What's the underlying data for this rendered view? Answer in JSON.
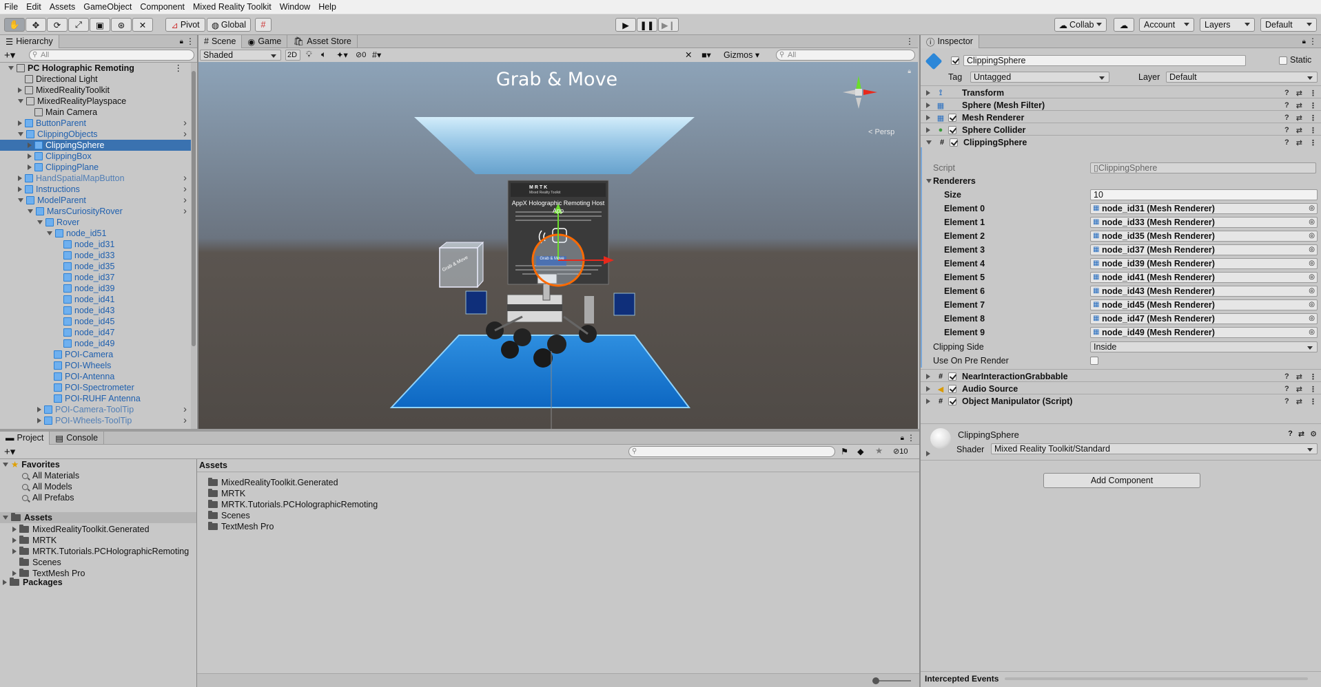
{
  "menu": [
    "File",
    "Edit",
    "Assets",
    "GameObject",
    "Component",
    "Mixed Reality Toolkit",
    "Window",
    "Help"
  ],
  "toolbar": {
    "pivot": "Pivot",
    "global": "Global",
    "collab": "Collab",
    "account": "Account",
    "layers": "Layers",
    "layout": "Default"
  },
  "hierarchy": {
    "tab": "Hierarchy",
    "search_placeholder": "All",
    "rows": [
      {
        "label": "PC Holographic Remoting",
        "depth": 0,
        "expand": "down",
        "blue": false,
        "bold": true,
        "icon": "unity-scene-icon"
      },
      {
        "label": "Directional Light",
        "depth": 1,
        "expand": "",
        "blue": false
      },
      {
        "label": "MixedRealityToolkit",
        "depth": 1,
        "expand": "right",
        "blue": false
      },
      {
        "label": "MixedRealityPlayspace",
        "depth": 1,
        "expand": "down",
        "blue": false
      },
      {
        "label": "Main Camera",
        "depth": 2,
        "expand": "",
        "blue": false
      },
      {
        "label": "ButtonParent",
        "depth": 1,
        "expand": "right",
        "blue": true,
        "chev": true
      },
      {
        "label": "ClippingObjects",
        "depth": 1,
        "expand": "down",
        "blue": true,
        "chev": true
      },
      {
        "label": "ClippingSphere",
        "depth": 2,
        "expand": "right",
        "blue": true,
        "selected": true
      },
      {
        "label": "ClippingBox",
        "depth": 2,
        "expand": "right",
        "blue": true
      },
      {
        "label": "ClippingPlane",
        "depth": 2,
        "expand": "right",
        "blue": true
      },
      {
        "label": "HandSpatialMapButton",
        "depth": 1,
        "expand": "right",
        "blue": true,
        "chev": true,
        "dim": true
      },
      {
        "label": "Instructions",
        "depth": 1,
        "expand": "right",
        "blue": true,
        "chev": true
      },
      {
        "label": "ModelParent",
        "depth": 1,
        "expand": "down",
        "blue": true,
        "chev": true
      },
      {
        "label": "MarsCuriosityRover",
        "depth": 2,
        "expand": "down",
        "blue": true,
        "chev": true
      },
      {
        "label": "Rover",
        "depth": 3,
        "expand": "down",
        "blue": true
      },
      {
        "label": "node_id51",
        "depth": 4,
        "expand": "down",
        "blue": true
      },
      {
        "label": "node_id31",
        "depth": 5,
        "expand": "",
        "blue": true
      },
      {
        "label": "node_id33",
        "depth": 5,
        "expand": "",
        "blue": true
      },
      {
        "label": "node_id35",
        "depth": 5,
        "expand": "",
        "blue": true
      },
      {
        "label": "node_id37",
        "depth": 5,
        "expand": "",
        "blue": true
      },
      {
        "label": "node_id39",
        "depth": 5,
        "expand": "",
        "blue": true
      },
      {
        "label": "node_id41",
        "depth": 5,
        "expand": "",
        "blue": true
      },
      {
        "label": "node_id43",
        "depth": 5,
        "expand": "",
        "blue": true
      },
      {
        "label": "node_id45",
        "depth": 5,
        "expand": "",
        "blue": true
      },
      {
        "label": "node_id47",
        "depth": 5,
        "expand": "",
        "blue": true
      },
      {
        "label": "node_id49",
        "depth": 5,
        "expand": "",
        "blue": true
      },
      {
        "label": "POI-Camera",
        "depth": 4,
        "expand": "",
        "blue": true
      },
      {
        "label": "POI-Wheels",
        "depth": 4,
        "expand": "",
        "blue": true
      },
      {
        "label": "POI-Antenna",
        "depth": 4,
        "expand": "",
        "blue": true
      },
      {
        "label": "POI-Spectrometer",
        "depth": 4,
        "expand": "",
        "blue": true
      },
      {
        "label": "POI-RUHF Antenna",
        "depth": 4,
        "expand": "",
        "blue": true
      },
      {
        "label": "POI-Camera-ToolTip",
        "depth": 3,
        "expand": "right",
        "blue": true,
        "chev": true,
        "dim": true
      },
      {
        "label": "POI-Wheels-ToolTip",
        "depth": 3,
        "expand": "right",
        "blue": true,
        "chev": true,
        "dim": true
      }
    ]
  },
  "scene": {
    "tabs": [
      "Scene",
      "Game",
      "Asset Store"
    ],
    "shading": "Shaded",
    "mode_2d": "2D",
    "hidden_count": "0",
    "gizmos": "Gizmos",
    "search_placeholder": "All",
    "persp": "< Persp",
    "title": "Grab & Move",
    "panel_title": "AppX Holographic Remoting Host App",
    "panel_brand": "MRTK",
    "panel_sub": "Mixed Reality Toolkit",
    "button_label": "Grab & Move",
    "box_label": "Grab & Move"
  },
  "project": {
    "tabs": [
      "Project",
      "Console"
    ],
    "count": "10",
    "favorites_label": "Favorites",
    "favorites": [
      "All Materials",
      "All Models",
      "All Prefabs"
    ],
    "assets_label": "Assets",
    "assets_tree": [
      "MixedRealityToolkit.Generated",
      "MRTK",
      "MRTK.Tutorials.PCHolographicRemoting",
      "Scenes",
      "TextMesh Pro"
    ],
    "packages_label": "Packages",
    "breadcrumb": "Assets",
    "asset_items": [
      "MixedRealityToolkit.Generated",
      "MRTK",
      "MRTK.Tutorials.PCHolographicRemoting",
      "Scenes",
      "TextMesh Pro"
    ]
  },
  "inspector": {
    "tab": "Inspector",
    "name": "ClippingSphere",
    "static_label": "Static",
    "tag_label": "Tag",
    "tag_value": "Untagged",
    "layer_label": "Layer",
    "layer_value": "Default",
    "components_top": [
      {
        "name": "Transform",
        "check": false,
        "icon": "transform-icon"
      },
      {
        "name": "Sphere (Mesh Filter)",
        "check": false,
        "icon": "mesh-filter-icon"
      },
      {
        "name": "Mesh Renderer",
        "check": true,
        "icon": "mesh-renderer-icon"
      },
      {
        "name": "Sphere Collider",
        "check": true,
        "icon": "sphere-collider-icon"
      },
      {
        "name": "ClippingSphere",
        "check": true,
        "icon": "script-icon",
        "expanded": true
      }
    ],
    "script_label": "Script",
    "script_value": "ClippingSphere",
    "renderers_label": "Renderers",
    "size_label": "Size",
    "size_value": "10",
    "elements": [
      {
        "label": "Element 0",
        "value": "node_id31 (Mesh Renderer)"
      },
      {
        "label": "Element 1",
        "value": "node_id33 (Mesh Renderer)"
      },
      {
        "label": "Element 2",
        "value": "node_id35 (Mesh Renderer)"
      },
      {
        "label": "Element 3",
        "value": "node_id37 (Mesh Renderer)"
      },
      {
        "label": "Element 4",
        "value": "node_id39 (Mesh Renderer)"
      },
      {
        "label": "Element 5",
        "value": "node_id41 (Mesh Renderer)"
      },
      {
        "label": "Element 6",
        "value": "node_id43 (Mesh Renderer)"
      },
      {
        "label": "Element 7",
        "value": "node_id45 (Mesh Renderer)"
      },
      {
        "label": "Element 8",
        "value": "node_id47 (Mesh Renderer)"
      },
      {
        "label": "Element 9",
        "value": "node_id49 (Mesh Renderer)"
      }
    ],
    "clipping_side_label": "Clipping Side",
    "clipping_side_value": "Inside",
    "use_on_pre_render_label": "Use On Pre Render",
    "components_bottom": [
      {
        "name": "NearInteractionGrabbable",
        "icon": "script-icon"
      },
      {
        "name": "Audio Source",
        "icon": "audio-source-icon"
      },
      {
        "name": "Object Manipulator (Script)",
        "icon": "script-icon"
      }
    ],
    "material_name": "ClippingSphere",
    "shader_label": "Shader",
    "shader_value": "Mixed Reality Toolkit/Standard",
    "add_component": "Add Component",
    "intercepted_events": "Intercepted Events"
  }
}
